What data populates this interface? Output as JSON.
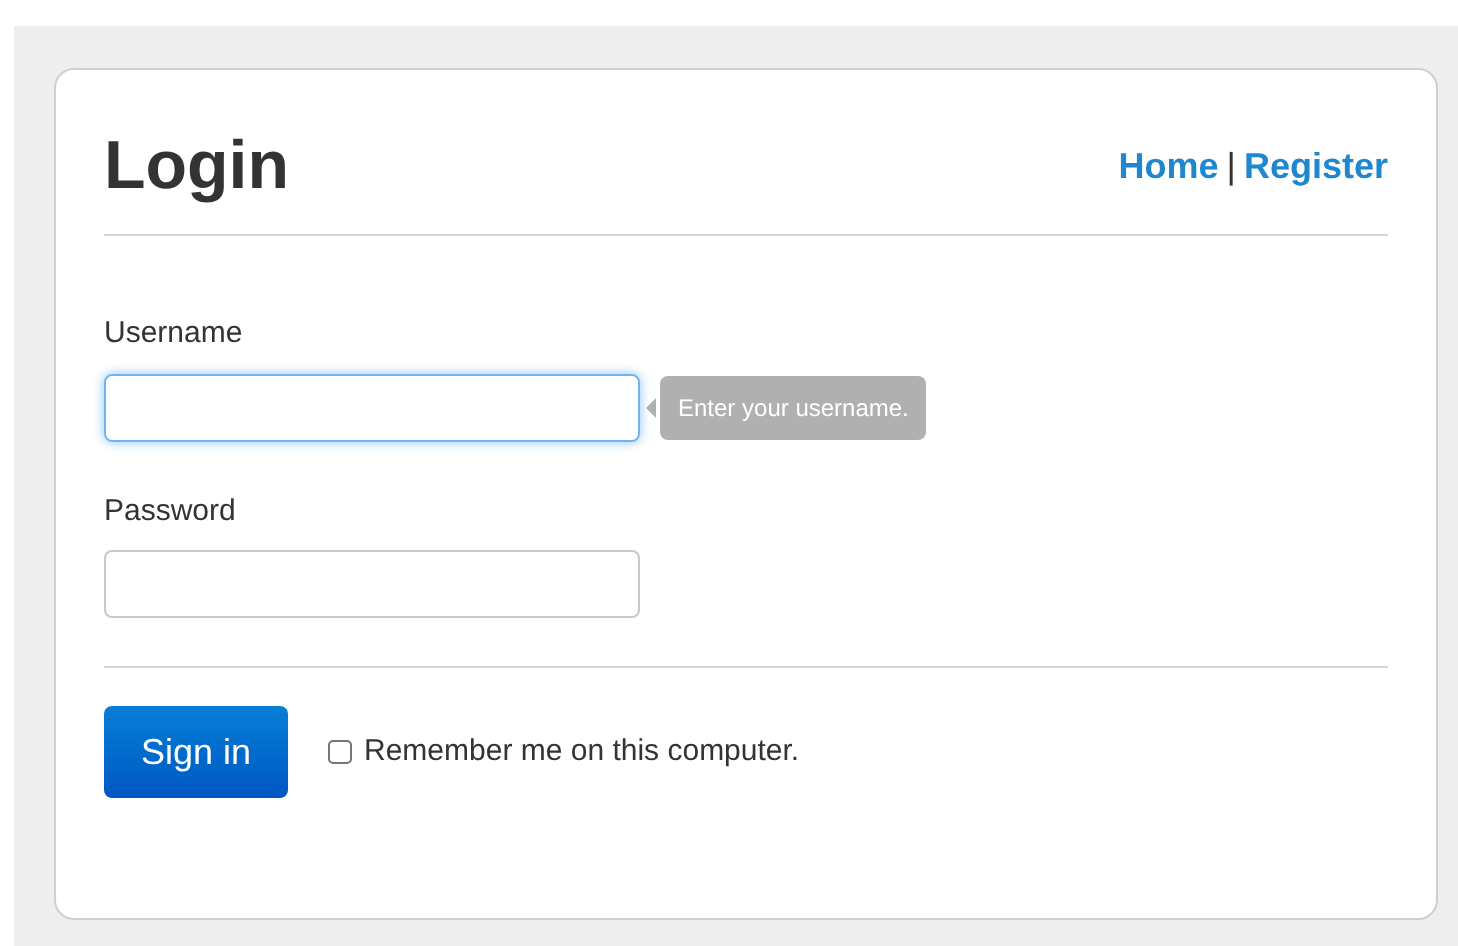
{
  "title": "Login",
  "nav_links": [
    {
      "label": "Home"
    },
    {
      "label": "Register"
    }
  ],
  "nav_separator": "|",
  "fields": [
    {
      "label": "Username",
      "focused": true,
      "hint": "Enter your username."
    },
    {
      "label": "Password",
      "focused": false
    }
  ],
  "submit_button": "Sign in",
  "remember": {
    "label": "Remember me on this computer.",
    "checked": false
  }
}
